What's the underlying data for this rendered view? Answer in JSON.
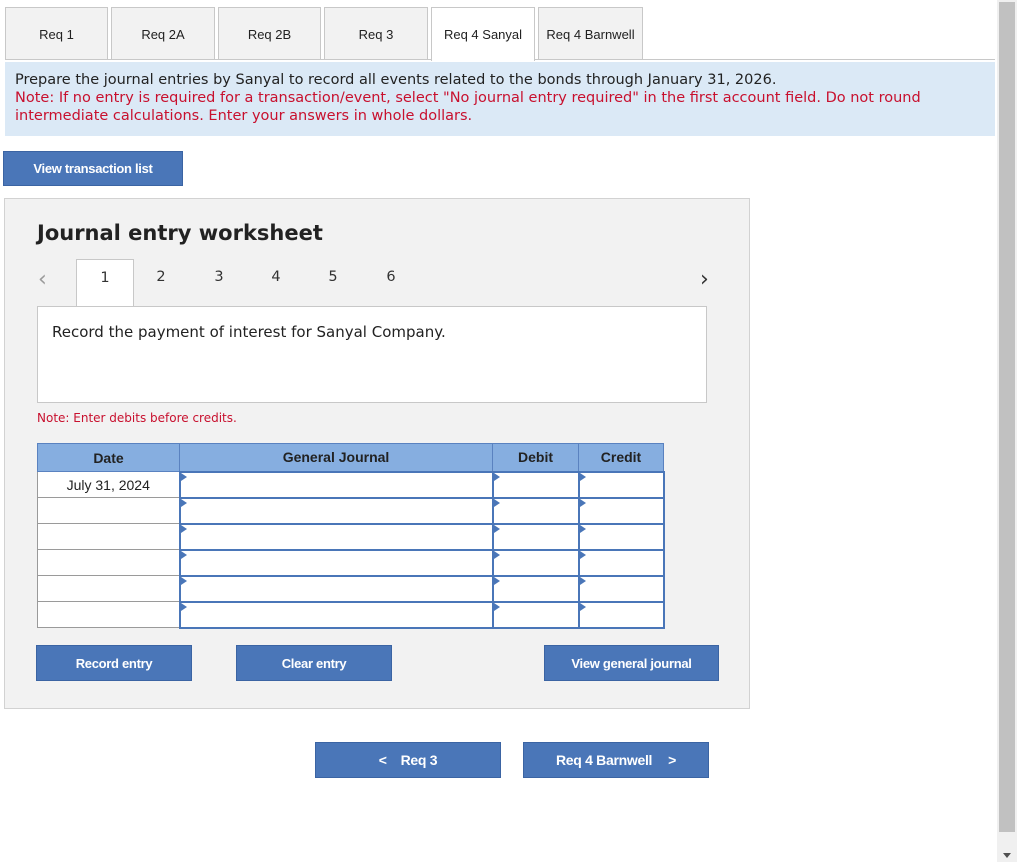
{
  "tabs": [
    {
      "label": "Req 1",
      "active": false
    },
    {
      "label": "Req 2A",
      "active": false
    },
    {
      "label": "Req 2B",
      "active": false
    },
    {
      "label": "Req 3",
      "active": false
    },
    {
      "label": "Req 4 Sanyal",
      "active": true
    },
    {
      "label": "Req 4 Barnwell",
      "active": false
    }
  ],
  "instructions": {
    "main": "Prepare the journal entries by Sanyal to record all events related to the bonds through January 31, 2026.",
    "note": "Note: If no entry is required for a transaction/event, select \"No journal entry required\" in the first account field. Do not round intermediate calculations. Enter your answers in whole dollars."
  },
  "view_transaction_list_label": "View transaction list",
  "worksheet": {
    "title": "Journal entry worksheet",
    "pages": [
      "1",
      "2",
      "3",
      "4",
      "5",
      "6"
    ],
    "active_page": "1",
    "prev_icon": "‹",
    "next_icon": "›",
    "description": "Record the payment of interest for Sanyal Company.",
    "note": "Note: Enter debits before credits.",
    "table": {
      "headers": {
        "date": "Date",
        "account": "General Journal",
        "debit": "Debit",
        "credit": "Credit"
      },
      "rows": [
        {
          "date": "July 31, 2024",
          "account": "",
          "debit": "",
          "credit": ""
        },
        {
          "date": "",
          "account": "",
          "debit": "",
          "credit": ""
        },
        {
          "date": "",
          "account": "",
          "debit": "",
          "credit": ""
        },
        {
          "date": "",
          "account": "",
          "debit": "",
          "credit": ""
        },
        {
          "date": "",
          "account": "",
          "debit": "",
          "credit": ""
        },
        {
          "date": "",
          "account": "",
          "debit": "",
          "credit": ""
        }
      ]
    },
    "buttons": {
      "record": "Record entry",
      "clear": "Clear entry",
      "view_journal": "View general journal"
    }
  },
  "nav": {
    "prev_label": "Req 3",
    "next_label": "Req 4 Barnwell",
    "prev_icon": "<",
    "next_icon": ">"
  }
}
